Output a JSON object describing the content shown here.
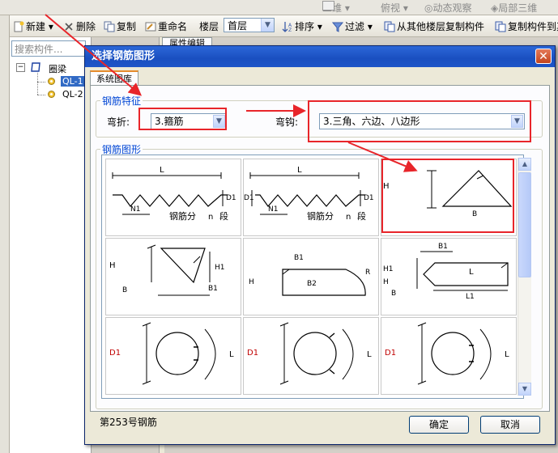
{
  "window": {
    "top_items": [
      "二维",
      "俯视",
      "动态观察",
      "局部三维"
    ],
    "left_tab_label": "x",
    "toolbar": {
      "new": "新建",
      "delete": "删除",
      "copy": "复制",
      "rename": "重命名",
      "floor_label": "楼层",
      "floor_value": "首层",
      "sort": "排序",
      "filter": "过滤",
      "copy_from_other_floor": "从其他楼层复制构件",
      "copy_to_other": "复制构件到其"
    },
    "search": {
      "placeholder": "搜索构件..."
    },
    "tree": {
      "root": "圈梁",
      "children": [
        "QL-1",
        "QL-2"
      ]
    },
    "behind_tab": "属性编辑"
  },
  "dialog": {
    "title": "选择钢筋图形",
    "close_glyph": "✕",
    "tab": "系统图库",
    "feature_group": "钢筋特征",
    "bend_label": "弯折:",
    "bend_value": "3.箍筋",
    "hook_label": "弯钩:",
    "hook_value": "3.三角、六边、八边形",
    "shape_group": "钢筋图形",
    "status": "第253号钢筋",
    "ok": "确定",
    "cancel": "取消",
    "shapes": [
      {
        "labels": [
          "L",
          "D1",
          "N1",
          "钢筋分",
          "n",
          "段"
        ]
      },
      {
        "labels": [
          "L",
          "D1",
          "D1",
          "N1",
          "钢筋分",
          "n",
          "段"
        ]
      },
      {
        "labels": [
          "H",
          "B"
        ]
      },
      {
        "labels": [
          "H",
          "H1",
          "B",
          "B1"
        ]
      },
      {
        "labels": [
          "B1",
          "B2",
          "H",
          "R"
        ]
      },
      {
        "labels": [
          "B1",
          "L",
          "H1",
          "H",
          "B",
          "L1"
        ]
      },
      {
        "labels": [
          "D1",
          "L"
        ]
      },
      {
        "labels": [
          "D1",
          "L"
        ]
      },
      {
        "labels": [
          "D1",
          "L"
        ]
      }
    ]
  },
  "colors": {
    "title_bar": "#1a4fc0",
    "group_label": "#0046d5",
    "highlight": "#e8252a",
    "annotation_arrow": "#e8252a",
    "d1_label": "#c00000"
  },
  "scroll_arrows": {
    "up": "▲",
    "down": "▼"
  },
  "icons": [
    "new-icon",
    "delete-icon",
    "copy-icon",
    "rename-icon",
    "sort-icon",
    "filter-icon",
    "copy-floor-icon",
    "tree-expand-icon",
    "folder-icon",
    "gear-icon"
  ]
}
